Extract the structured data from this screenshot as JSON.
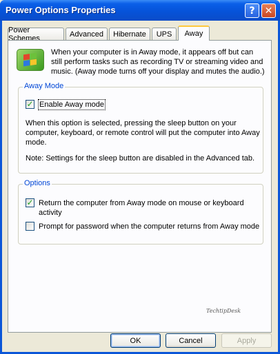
{
  "window": {
    "title": "Power Options Properties"
  },
  "titlebar": {
    "help_glyph": "?",
    "close_glyph": "✕"
  },
  "tabs": [
    {
      "label": "Power Schemes"
    },
    {
      "label": "Advanced"
    },
    {
      "label": "Hibernate"
    },
    {
      "label": "UPS"
    },
    {
      "label": "Away"
    }
  ],
  "away": {
    "intro": "When your computer is in Away mode, it appears off but can still perform tasks such as recording TV or streaming video and music. (Away mode turns off your display and mutes the audio.)",
    "away_mode_group": {
      "title": "Away Mode",
      "enable_label": "Enable Away mode",
      "enable_checked": true,
      "description": "When this option is selected, pressing the sleep button on your computer, keyboard, or remote control will put the computer into Away mode.",
      "note": "Note: Settings for the sleep button are disabled in the Advanced tab."
    },
    "options_group": {
      "title": "Options",
      "return_label": "Return the computer from Away mode on mouse or keyboard activity",
      "return_checked": true,
      "prompt_label": "Prompt for password when the computer returns from Away mode",
      "prompt_checked": false
    },
    "watermark": "TechtipDesk"
  },
  "buttons": {
    "ok": "OK",
    "cancel": "Cancel",
    "apply": "Apply"
  },
  "colors": {
    "titlebar": "#0653d9",
    "group_title": "#0046d5",
    "check_tick": "#21a121"
  }
}
